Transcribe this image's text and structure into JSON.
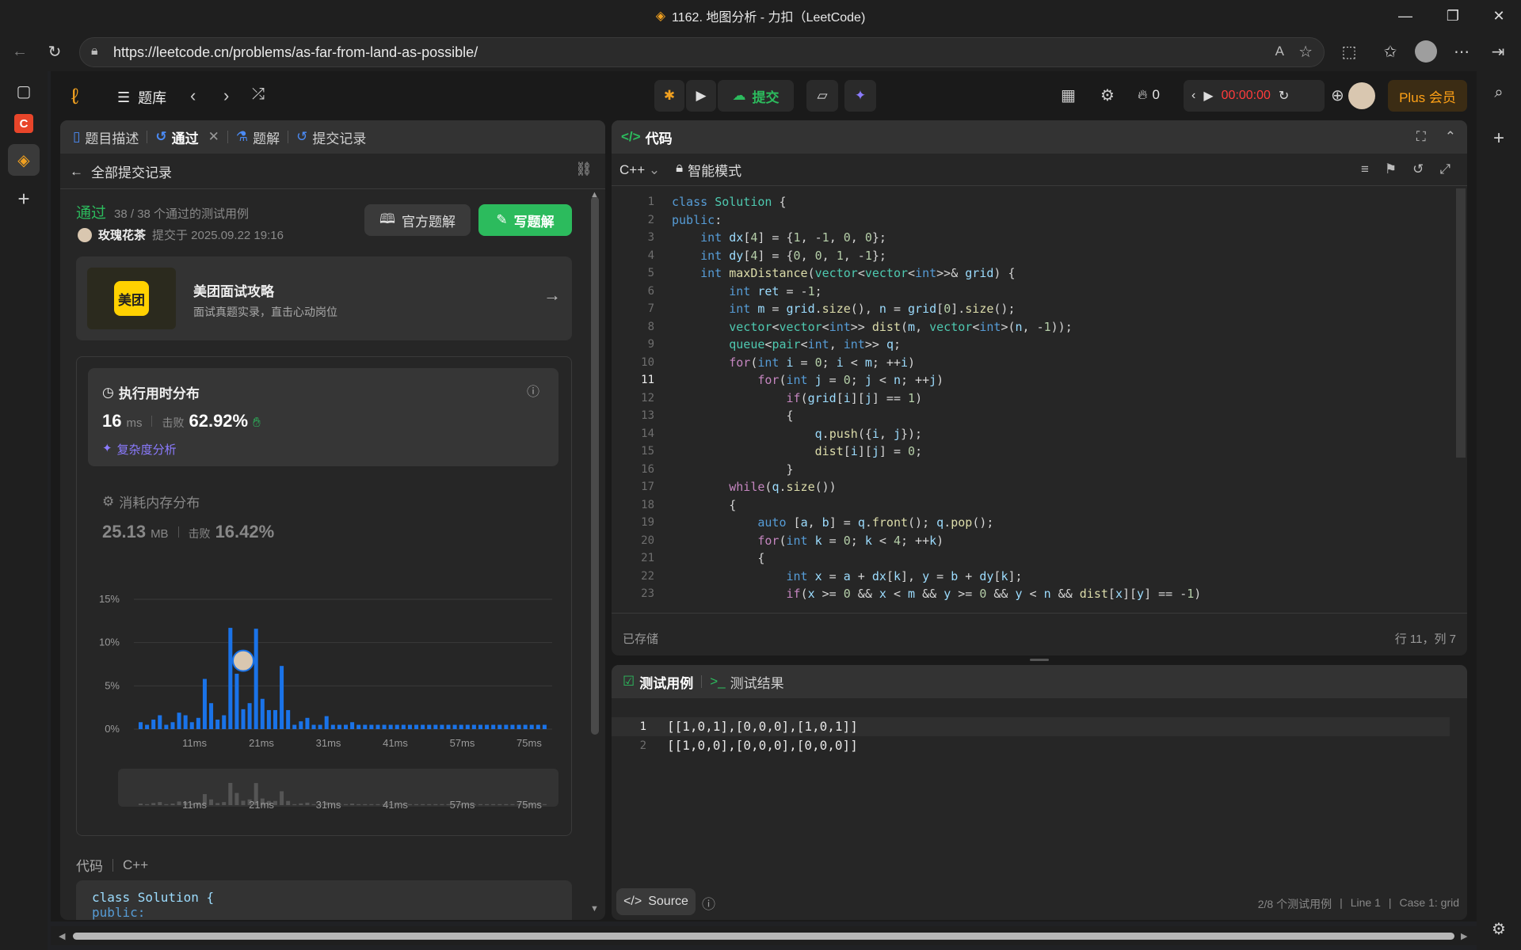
{
  "browser": {
    "window_title": "1162. 地图分析 - 力扣（LeetCode)",
    "url": "https://leetcode.cn/problems/as-far-from-land-as-possible/",
    "min_glyph": "—",
    "restore_glyph": "❐",
    "close_glyph": "✕"
  },
  "topnav": {
    "problem_bank": "题库",
    "submit": "提交",
    "streak_count": "0",
    "timer": "00:00:00",
    "plus": "Plus 会员"
  },
  "left_tabs": {
    "description": "题目描述",
    "accepted": "通过",
    "solutions": "题解",
    "submissions": "提交记录"
  },
  "submission": {
    "back_label": "全部提交记录",
    "status": "通过",
    "testcases_passed": "38 / 38 个通过的测试用例",
    "user": "玫瑰花茶",
    "submitted_at": "提交于 2025.09.22 19:16",
    "official_solution": "官方题解",
    "write_solution": "写题解"
  },
  "banner": {
    "logo_text": "美团",
    "title": "美团面试攻略",
    "subtitle": "面试真题实录，直击心动岗位"
  },
  "runtime": {
    "title": "执行用时分布",
    "value": "16",
    "unit": "ms",
    "beats_label": "击败",
    "beats": "62.92%",
    "complexity": "复杂度分析"
  },
  "memory": {
    "title": "消耗内存分布",
    "value": "25.13",
    "unit": "MB",
    "beats_label": "击败",
    "beats": "16.42%"
  },
  "chart_data": {
    "type": "bar",
    "title": "",
    "y_ticks": [
      "15%",
      "10%",
      "5%",
      "0%"
    ],
    "ylim": [
      0,
      15
    ],
    "x_ticks": [
      "11ms",
      "21ms",
      "31ms",
      "41ms",
      "57ms",
      "75ms"
    ],
    "values": [
      0.8,
      0.5,
      1.1,
      1.6,
      0.5,
      0.8,
      1.9,
      1.6,
      0.8,
      1.3,
      5.8,
      3.0,
      1.1,
      1.6,
      11.7,
      6.4,
      2.3,
      3.0,
      11.6,
      3.5,
      2.2,
      2.2,
      7.3,
      2.2,
      0.5,
      0.9,
      1.3,
      0.5,
      0.5,
      1.5,
      0.5,
      0.5,
      0.5,
      0.8,
      0.5,
      0.5,
      0.5,
      0.5,
      0.5,
      0.5,
      0.5,
      0.5,
      0.5,
      0.5,
      0.5,
      0.5,
      0.5,
      0.5,
      0.5,
      0.5,
      0.5,
      0.5,
      0.5,
      0.5,
      0.5,
      0.5,
      0.5,
      0.5,
      0.5,
      0.5,
      0.5,
      0.5,
      0.5,
      0.5
    ],
    "highlight_index": 16,
    "bar_color": "#1a73e8"
  },
  "code_footer": {
    "label": "代码",
    "lang": "C++",
    "line1": "class Solution {",
    "line2": "public:"
  },
  "editor": {
    "title": "代码",
    "language": "C++",
    "mode": "智能模式",
    "saved": "已存储",
    "cursor": "行 11，列 7",
    "lines": [
      "class Solution {",
      "public:",
      "    int dx[4] = {1, -1, 0, 0};",
      "    int dy[4] = {0, 0, 1, -1};",
      "    int maxDistance(vector<vector<int>>& grid) {",
      "        int ret = -1;",
      "        int m = grid.size(), n = grid[0].size();",
      "        vector<vector<int>> dist(m, vector<int>(n, -1));",
      "        queue<pair<int, int>> q;",
      "        for(int i = 0; i < m; ++i)",
      "            for(int j = 0; j < n; ++j)",
      "                if(grid[i][j] == 1)",
      "                {",
      "                    q.push({i, j});",
      "                    dist[i][j] = 0;",
      "                }",
      "        while(q.size())",
      "        {",
      "            auto [a, b] = q.front(); q.pop();",
      "            for(int k = 0; k < 4; ++k)",
      "            {",
      "                int x = a + dx[k], y = b + dy[k];",
      "                if(x >= 0 && x < m && y >= 0 && y < n && dist[x][y] == -1)",
      "                {"
    ],
    "active_line": 11
  },
  "testcase": {
    "tab_cases": "测试用例",
    "tab_results": "测试结果",
    "cases": [
      "[[1,0,1],[0,0,0],[1,0,1]]",
      "[[1,0,0],[0,0,0],[0,0,0]]"
    ],
    "source_btn": "Source",
    "status_count": "2/8 个测试用例",
    "status_line": "Line 1",
    "status_case": "Case 1: grid"
  }
}
